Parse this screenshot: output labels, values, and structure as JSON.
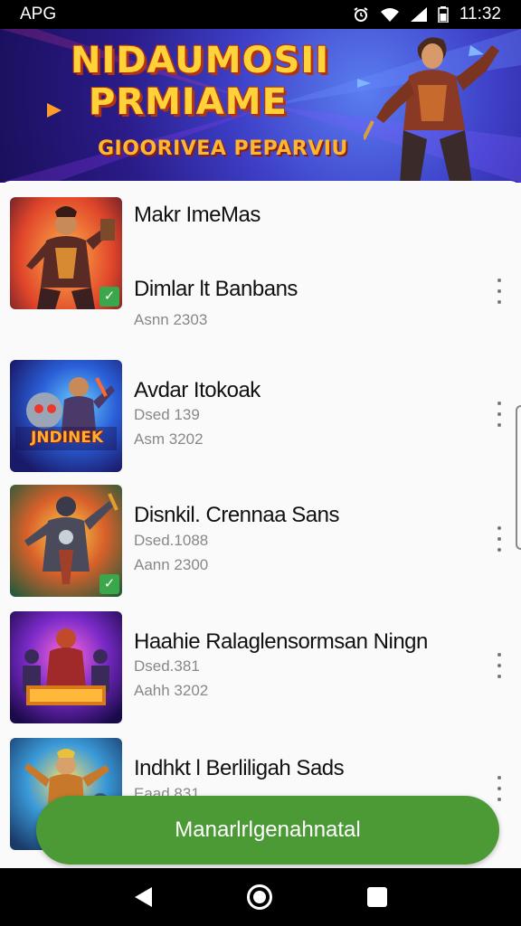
{
  "status_bar": {
    "carrier": "APG",
    "time": "11:32",
    "icons": [
      "alarm-icon",
      "wifi-icon",
      "signal-icon",
      "battery-icon"
    ]
  },
  "banner": {
    "title_line1": "NIDAUMOSII",
    "title_line2": "PRMIAME",
    "subtitle": "GIOORIVEA PEPARVIU"
  },
  "list": {
    "header": "Makr ImeMas",
    "items": [
      {
        "title": "Dimlar lt Banbans",
        "line1": "Asnn 2303",
        "line2": "",
        "verified": true
      },
      {
        "title": "Avdar Itokoak",
        "line1": "Dsed 139",
        "line2": "Asm 3202",
        "verified": false,
        "thumb_text": "JNDINEK"
      },
      {
        "title": "Disnkil. Crennaa Sans",
        "line1": "Dsed.1088",
        "line2": "Aann 2300",
        "verified": true
      },
      {
        "title": "Haahie Ralaglensormsan Ningn",
        "line1": "Dsed.381",
        "line2": "Aahh 3202",
        "verified": false
      },
      {
        "title": "Indhkt l Berliligah Sads",
        "line1": "Eaad 831",
        "line2": "",
        "verified": false
      }
    ]
  },
  "cta": {
    "label": "Manarlrlgenahnatal"
  },
  "colors": {
    "cta_green": "#4c9a36",
    "banner_title": "#ffd23a",
    "banner_bg": "#3d3fc7"
  }
}
